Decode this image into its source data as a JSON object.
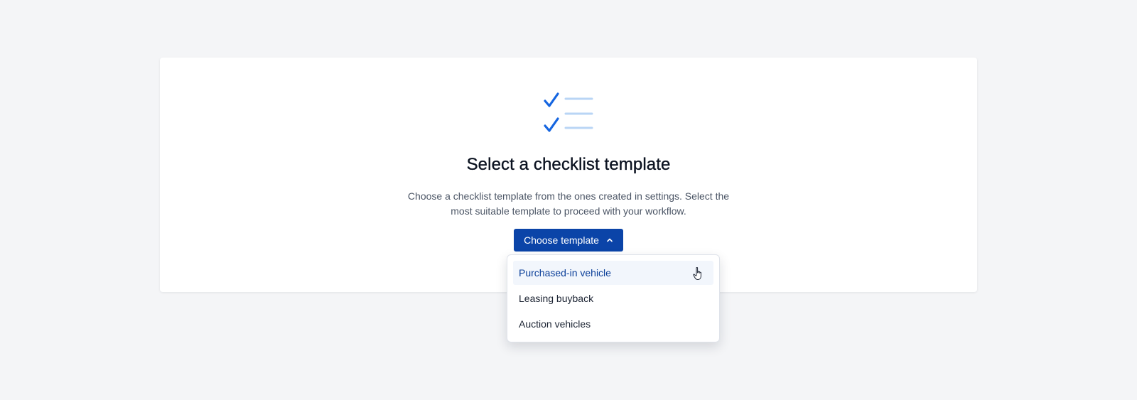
{
  "empty_state": {
    "title": "Select a checklist template",
    "description": "Choose a checklist template from the ones created in settings. Select the most suitable template to proceed with your workflow.",
    "illustration_icon": "checklist-icon"
  },
  "template_button": {
    "label": "Choose template",
    "icon": "chevron-up-icon",
    "expanded": true
  },
  "dropdown": {
    "options": [
      {
        "label": "Purchased-in vehicle",
        "hovered": true
      },
      {
        "label": "Leasing buyback",
        "hovered": false
      },
      {
        "label": "Auction vehicles",
        "hovered": false
      }
    ]
  },
  "colors": {
    "background": "#f4f5f7",
    "card": "#ffffff",
    "primary_button": "#0b44a8",
    "check_mark": "#1565e0",
    "list_lines": "#b9d5f5",
    "hover_row": "#f2f6fc",
    "hover_text": "#0b3f99"
  }
}
